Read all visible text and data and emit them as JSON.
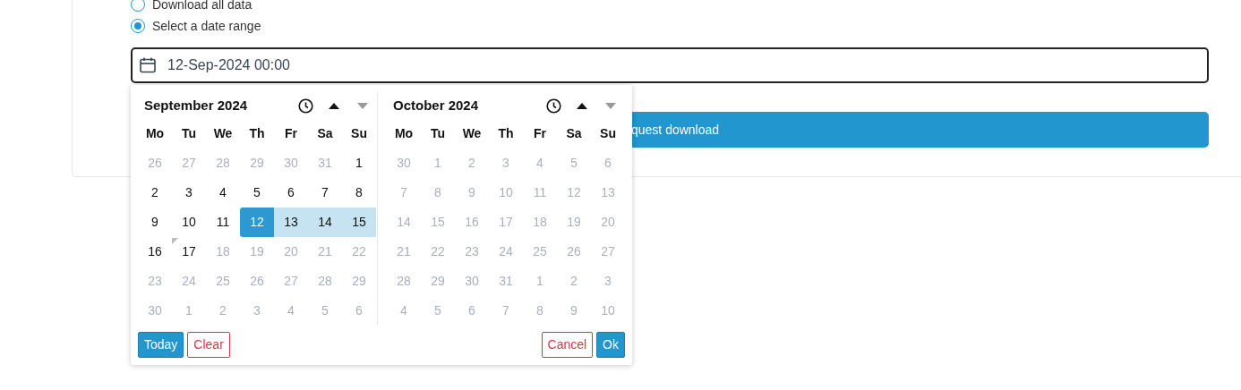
{
  "options": [
    {
      "label": "Download all data",
      "selected": false
    },
    {
      "label": "Select a date range",
      "selected": true
    }
  ],
  "date_field": {
    "value": "12-Sep-2024 00:00"
  },
  "request_button": {
    "label": "quest download"
  },
  "picker": {
    "months": [
      {
        "title": "September 2024",
        "up_disabled": false,
        "down_disabled": true,
        "weekdays": [
          "Mo",
          "Tu",
          "We",
          "Th",
          "Fr",
          "Sa",
          "Su"
        ],
        "weeks": [
          [
            {
              "text": "26",
              "disabled": true,
              "selected": false,
              "in_range": false,
              "today": false
            },
            {
              "text": "27",
              "disabled": true,
              "selected": false,
              "in_range": false,
              "today": false
            },
            {
              "text": "28",
              "disabled": true,
              "selected": false,
              "in_range": false,
              "today": false
            },
            {
              "text": "29",
              "disabled": true,
              "selected": false,
              "in_range": false,
              "today": false
            },
            {
              "text": "30",
              "disabled": true,
              "selected": false,
              "in_range": false,
              "today": false
            },
            {
              "text": "31",
              "disabled": true,
              "selected": false,
              "in_range": false,
              "today": false
            },
            {
              "text": "1",
              "disabled": false,
              "selected": false,
              "in_range": false,
              "today": false
            }
          ],
          [
            {
              "text": "2",
              "disabled": false,
              "selected": false,
              "in_range": false,
              "today": false
            },
            {
              "text": "3",
              "disabled": false,
              "selected": false,
              "in_range": false,
              "today": false
            },
            {
              "text": "4",
              "disabled": false,
              "selected": false,
              "in_range": false,
              "today": false
            },
            {
              "text": "5",
              "disabled": false,
              "selected": false,
              "in_range": false,
              "today": false
            },
            {
              "text": "6",
              "disabled": false,
              "selected": false,
              "in_range": false,
              "today": false
            },
            {
              "text": "7",
              "disabled": false,
              "selected": false,
              "in_range": false,
              "today": false
            },
            {
              "text": "8",
              "disabled": false,
              "selected": false,
              "in_range": false,
              "today": false
            }
          ],
          [
            {
              "text": "9",
              "disabled": false,
              "selected": false,
              "in_range": false,
              "today": false
            },
            {
              "text": "10",
              "disabled": false,
              "selected": false,
              "in_range": false,
              "today": false
            },
            {
              "text": "11",
              "disabled": false,
              "selected": false,
              "in_range": false,
              "today": false
            },
            {
              "text": "12",
              "disabled": false,
              "selected": true,
              "in_range": false,
              "today": false
            },
            {
              "text": "13",
              "disabled": false,
              "selected": false,
              "in_range": true,
              "today": false
            },
            {
              "text": "14",
              "disabled": false,
              "selected": false,
              "in_range": true,
              "today": false
            },
            {
              "text": "15",
              "disabled": false,
              "selected": false,
              "in_range": true,
              "today": false
            }
          ],
          [
            {
              "text": "16",
              "disabled": false,
              "selected": false,
              "in_range": false,
              "today": false
            },
            {
              "text": "17",
              "disabled": false,
              "selected": false,
              "in_range": false,
              "today": true
            },
            {
              "text": "18",
              "disabled": true,
              "selected": false,
              "in_range": false,
              "today": false
            },
            {
              "text": "19",
              "disabled": true,
              "selected": false,
              "in_range": false,
              "today": false
            },
            {
              "text": "20",
              "disabled": true,
              "selected": false,
              "in_range": false,
              "today": false
            },
            {
              "text": "21",
              "disabled": true,
              "selected": false,
              "in_range": false,
              "today": false
            },
            {
              "text": "22",
              "disabled": true,
              "selected": false,
              "in_range": false,
              "today": false
            }
          ],
          [
            {
              "text": "23",
              "disabled": true,
              "selected": false,
              "in_range": false,
              "today": false
            },
            {
              "text": "24",
              "disabled": true,
              "selected": false,
              "in_range": false,
              "today": false
            },
            {
              "text": "25",
              "disabled": true,
              "selected": false,
              "in_range": false,
              "today": false
            },
            {
              "text": "26",
              "disabled": true,
              "selected": false,
              "in_range": false,
              "today": false
            },
            {
              "text": "27",
              "disabled": true,
              "selected": false,
              "in_range": false,
              "today": false
            },
            {
              "text": "28",
              "disabled": true,
              "selected": false,
              "in_range": false,
              "today": false
            },
            {
              "text": "29",
              "disabled": true,
              "selected": false,
              "in_range": false,
              "today": false
            }
          ],
          [
            {
              "text": "30",
              "disabled": true,
              "selected": false,
              "in_range": false,
              "today": false
            },
            {
              "text": "1",
              "disabled": true,
              "selected": false,
              "in_range": false,
              "today": false
            },
            {
              "text": "2",
              "disabled": true,
              "selected": false,
              "in_range": false,
              "today": false
            },
            {
              "text": "3",
              "disabled": true,
              "selected": false,
              "in_range": false,
              "today": false
            },
            {
              "text": "4",
              "disabled": true,
              "selected": false,
              "in_range": false,
              "today": false
            },
            {
              "text": "5",
              "disabled": true,
              "selected": false,
              "in_range": false,
              "today": false
            },
            {
              "text": "6",
              "disabled": true,
              "selected": false,
              "in_range": false,
              "today": false
            }
          ]
        ]
      },
      {
        "title": "October 2024",
        "up_disabled": false,
        "down_disabled": true,
        "weekdays": [
          "Mo",
          "Tu",
          "We",
          "Th",
          "Fr",
          "Sa",
          "Su"
        ],
        "weeks": [
          [
            {
              "text": "30",
              "disabled": true,
              "selected": false,
              "in_range": false,
              "today": false
            },
            {
              "text": "1",
              "disabled": true,
              "selected": false,
              "in_range": false,
              "today": false
            },
            {
              "text": "2",
              "disabled": true,
              "selected": false,
              "in_range": false,
              "today": false
            },
            {
              "text": "3",
              "disabled": true,
              "selected": false,
              "in_range": false,
              "today": false
            },
            {
              "text": "4",
              "disabled": true,
              "selected": false,
              "in_range": false,
              "today": false
            },
            {
              "text": "5",
              "disabled": true,
              "selected": false,
              "in_range": false,
              "today": false
            },
            {
              "text": "6",
              "disabled": true,
              "selected": false,
              "in_range": false,
              "today": false
            }
          ],
          [
            {
              "text": "7",
              "disabled": true,
              "selected": false,
              "in_range": false,
              "today": false
            },
            {
              "text": "8",
              "disabled": true,
              "selected": false,
              "in_range": false,
              "today": false
            },
            {
              "text": "9",
              "disabled": true,
              "selected": false,
              "in_range": false,
              "today": false
            },
            {
              "text": "10",
              "disabled": true,
              "selected": false,
              "in_range": false,
              "today": false
            },
            {
              "text": "11",
              "disabled": true,
              "selected": false,
              "in_range": false,
              "today": false
            },
            {
              "text": "12",
              "disabled": true,
              "selected": false,
              "in_range": false,
              "today": false
            },
            {
              "text": "13",
              "disabled": true,
              "selected": false,
              "in_range": false,
              "today": false
            }
          ],
          [
            {
              "text": "14",
              "disabled": true,
              "selected": false,
              "in_range": false,
              "today": false
            },
            {
              "text": "15",
              "disabled": true,
              "selected": false,
              "in_range": false,
              "today": false
            },
            {
              "text": "16",
              "disabled": true,
              "selected": false,
              "in_range": false,
              "today": false
            },
            {
              "text": "17",
              "disabled": true,
              "selected": false,
              "in_range": false,
              "today": false
            },
            {
              "text": "18",
              "disabled": true,
              "selected": false,
              "in_range": false,
              "today": false
            },
            {
              "text": "19",
              "disabled": true,
              "selected": false,
              "in_range": false,
              "today": false
            },
            {
              "text": "20",
              "disabled": true,
              "selected": false,
              "in_range": false,
              "today": false
            }
          ],
          [
            {
              "text": "21",
              "disabled": true,
              "selected": false,
              "in_range": false,
              "today": false
            },
            {
              "text": "22",
              "disabled": true,
              "selected": false,
              "in_range": false,
              "today": false
            },
            {
              "text": "23",
              "disabled": true,
              "selected": false,
              "in_range": false,
              "today": false
            },
            {
              "text": "24",
              "disabled": true,
              "selected": false,
              "in_range": false,
              "today": false
            },
            {
              "text": "25",
              "disabled": true,
              "selected": false,
              "in_range": false,
              "today": false
            },
            {
              "text": "26",
              "disabled": true,
              "selected": false,
              "in_range": false,
              "today": false
            },
            {
              "text": "27",
              "disabled": true,
              "selected": false,
              "in_range": false,
              "today": false
            }
          ],
          [
            {
              "text": "28",
              "disabled": true,
              "selected": false,
              "in_range": false,
              "today": false
            },
            {
              "text": "29",
              "disabled": true,
              "selected": false,
              "in_range": false,
              "today": false
            },
            {
              "text": "30",
              "disabled": true,
              "selected": false,
              "in_range": false,
              "today": false
            },
            {
              "text": "31",
              "disabled": true,
              "selected": false,
              "in_range": false,
              "today": false
            },
            {
              "text": "1",
              "disabled": true,
              "selected": false,
              "in_range": false,
              "today": false
            },
            {
              "text": "2",
              "disabled": true,
              "selected": false,
              "in_range": false,
              "today": false
            },
            {
              "text": "3",
              "disabled": true,
              "selected": false,
              "in_range": false,
              "today": false
            }
          ],
          [
            {
              "text": "4",
              "disabled": true,
              "selected": false,
              "in_range": false,
              "today": false
            },
            {
              "text": "5",
              "disabled": true,
              "selected": false,
              "in_range": false,
              "today": false
            },
            {
              "text": "6",
              "disabled": true,
              "selected": false,
              "in_range": false,
              "today": false
            },
            {
              "text": "7",
              "disabled": true,
              "selected": false,
              "in_range": false,
              "today": false
            },
            {
              "text": "8",
              "disabled": true,
              "selected": false,
              "in_range": false,
              "today": false
            },
            {
              "text": "9",
              "disabled": true,
              "selected": false,
              "in_range": false,
              "today": false
            },
            {
              "text": "10",
              "disabled": true,
              "selected": false,
              "in_range": false,
              "today": false
            }
          ]
        ]
      }
    ],
    "left_buttons": [
      {
        "label": "Today",
        "kind": "primary"
      },
      {
        "label": "Clear",
        "kind": "danger"
      }
    ],
    "right_buttons": [
      {
        "label": "Cancel",
        "kind": "danger"
      },
      {
        "label": "Ok",
        "kind": "primary"
      }
    ]
  }
}
